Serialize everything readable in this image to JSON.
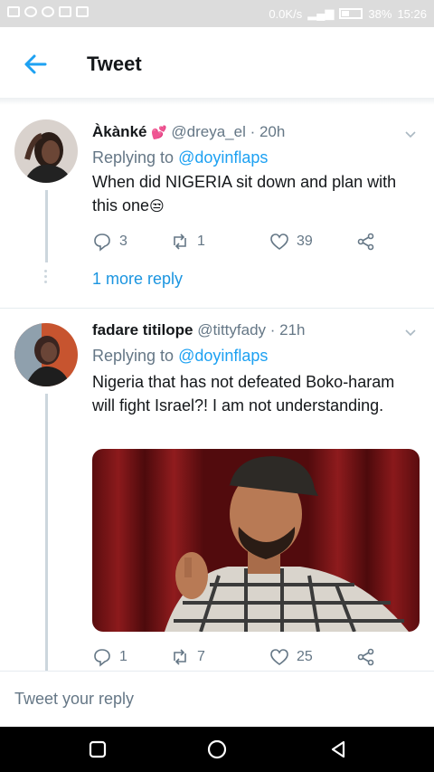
{
  "status_bar": {
    "network_speed": "0.0K/s",
    "battery": "38%",
    "time": "15:26"
  },
  "header": {
    "title": "Tweet",
    "back_icon": "arrow-left-icon"
  },
  "tweets": [
    {
      "name": "Àkànké",
      "name_emoji": "💕",
      "handle": "@dreya_el · 20h",
      "replying_prefix": "Replying to ",
      "replying_to": "@doyinflaps",
      "text": "When did NIGERIA sit down and plan with this one",
      "text_emoji": "😒",
      "replies": "3",
      "retweets": "1",
      "likes": "39",
      "more_replies": "1 more reply"
    },
    {
      "name": "fadare titilope",
      "handle": "@tittyfady · 21h",
      "replying_prefix": "Replying to ",
      "replying_to": "@doyinflaps",
      "text": "Nigeria that has not defeated Boko-haram will fight Israel?! I am not understanding.",
      "has_media": true,
      "replies": "1",
      "retweets": "7",
      "likes": "25"
    }
  ],
  "reply_bar": {
    "placeholder": "Tweet your reply"
  },
  "colors": {
    "link": "#1da1f2",
    "muted": "#657786",
    "text": "#14171a"
  }
}
